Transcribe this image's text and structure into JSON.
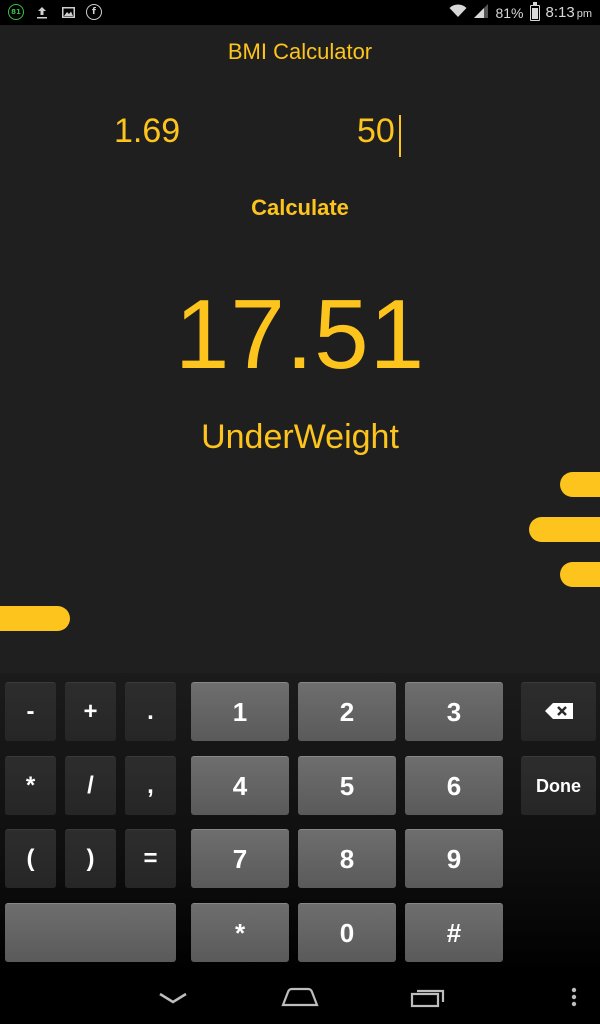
{
  "status_bar": {
    "notification_badge": "81",
    "icons": [
      "app-81-icon",
      "upload-icon",
      "image-icon",
      "facebook-icon"
    ],
    "battery": "81%",
    "time": "8:13",
    "ampm": "pm"
  },
  "app": {
    "title": "BMI Calculator",
    "height_value": "1.69",
    "weight_value": "50",
    "calculate_label": "Calculate",
    "bmi_value": "17.51",
    "bmi_category": "UnderWeight",
    "accent_color": "#fcc41c",
    "background_color": "#1f1f1f"
  },
  "keyboard": {
    "keys": {
      "minus": "-",
      "plus": "+",
      "period": ".",
      "one": "1",
      "two": "2",
      "three": "3",
      "asterisk": "*",
      "slash": "/",
      "comma": ",",
      "four": "4",
      "five": "5",
      "six": "6",
      "lparen": "(",
      "rparen": ")",
      "equals": "=",
      "seven": "7",
      "eight": "8",
      "nine": "9",
      "space": "",
      "star": "*",
      "zero": "0",
      "hash": "#",
      "done": "Done"
    }
  }
}
